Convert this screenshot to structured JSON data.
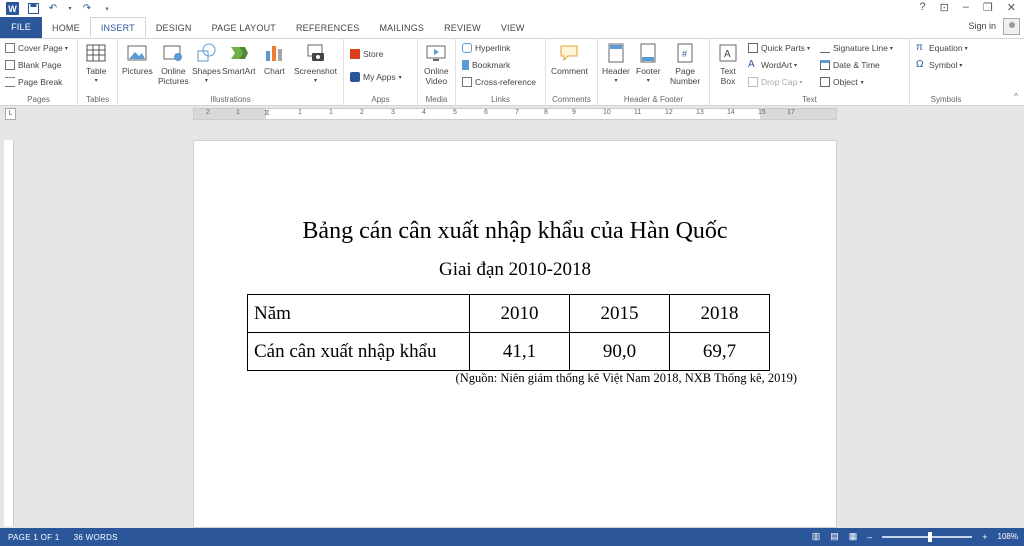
{
  "tabs": [
    {
      "label": "FILE"
    },
    {
      "label": "HOME"
    },
    {
      "label": "INSERT"
    },
    {
      "label": "DESIGN"
    },
    {
      "label": "PAGE LAYOUT"
    },
    {
      "label": "REFERENCES"
    },
    {
      "label": "MAILINGS"
    },
    {
      "label": "REVIEW"
    },
    {
      "label": "VIEW"
    }
  ],
  "account": {
    "sign_in": "Sign in"
  },
  "ribbon": {
    "pages": {
      "label": "Pages",
      "cover": "Cover Page",
      "blank": "Blank Page",
      "break": "Page Break"
    },
    "tables": {
      "label": "Tables",
      "table": "Table"
    },
    "illustrations": {
      "label": "Illustrations",
      "pictures": "Pictures",
      "online1": "Online",
      "online2": "Pictures",
      "shapes": "Shapes",
      "smartart": "SmartArt",
      "chart": "Chart",
      "screenshot": "Screenshot"
    },
    "apps": {
      "label": "Apps",
      "store": "Store",
      "myapps": "My Apps"
    },
    "media": {
      "label": "Media",
      "online1": "Online",
      "online2": "Video"
    },
    "links": {
      "label": "Links",
      "hyperlink": "Hyperlink",
      "bookmark": "Bookmark",
      "crossref": "Cross-reference"
    },
    "comments": {
      "label": "Comments",
      "comment": "Comment"
    },
    "headerfooter": {
      "label": "Header & Footer",
      "header": "Header",
      "footer": "Footer",
      "pn1": "Page",
      "pn2": "Number"
    },
    "text": {
      "label": "Text",
      "tb1": "Text",
      "tb2": "Box",
      "quickparts": "Quick Parts",
      "wordart": "WordArt",
      "dropcap": "Drop Cap",
      "sigline": "Signature Line",
      "datetime": "Date & Time",
      "object": "Object"
    },
    "symbols": {
      "label": "Symbols",
      "equation": "Equation",
      "symbol": "Symbol"
    }
  },
  "ruler": {
    "ticks": [
      "2",
      "1",
      "1",
      "1",
      "2",
      "3",
      "4",
      "5",
      "6",
      "7",
      "8",
      "9",
      "10",
      "11",
      "12",
      "13",
      "14",
      "15",
      "17"
    ]
  },
  "document": {
    "title": "Bảng cán cân xuất nhập khẩu của Hàn Quốc",
    "subtitle": "Giai đạn 2010-2018",
    "table": {
      "headers": [
        "Năm",
        "2010",
        "2015",
        "2018"
      ],
      "row": [
        "Cán cân xuất nhập khẩu",
        "41,1",
        "90,0",
        "69,7"
      ]
    },
    "source": "(Nguồn: Niên giám thống kê Việt Nam 2018, NXB Thống kê, 2019)"
  },
  "status": {
    "page": "PAGE 1 OF 1",
    "words": "36 WORDS",
    "zoom": "108%"
  }
}
